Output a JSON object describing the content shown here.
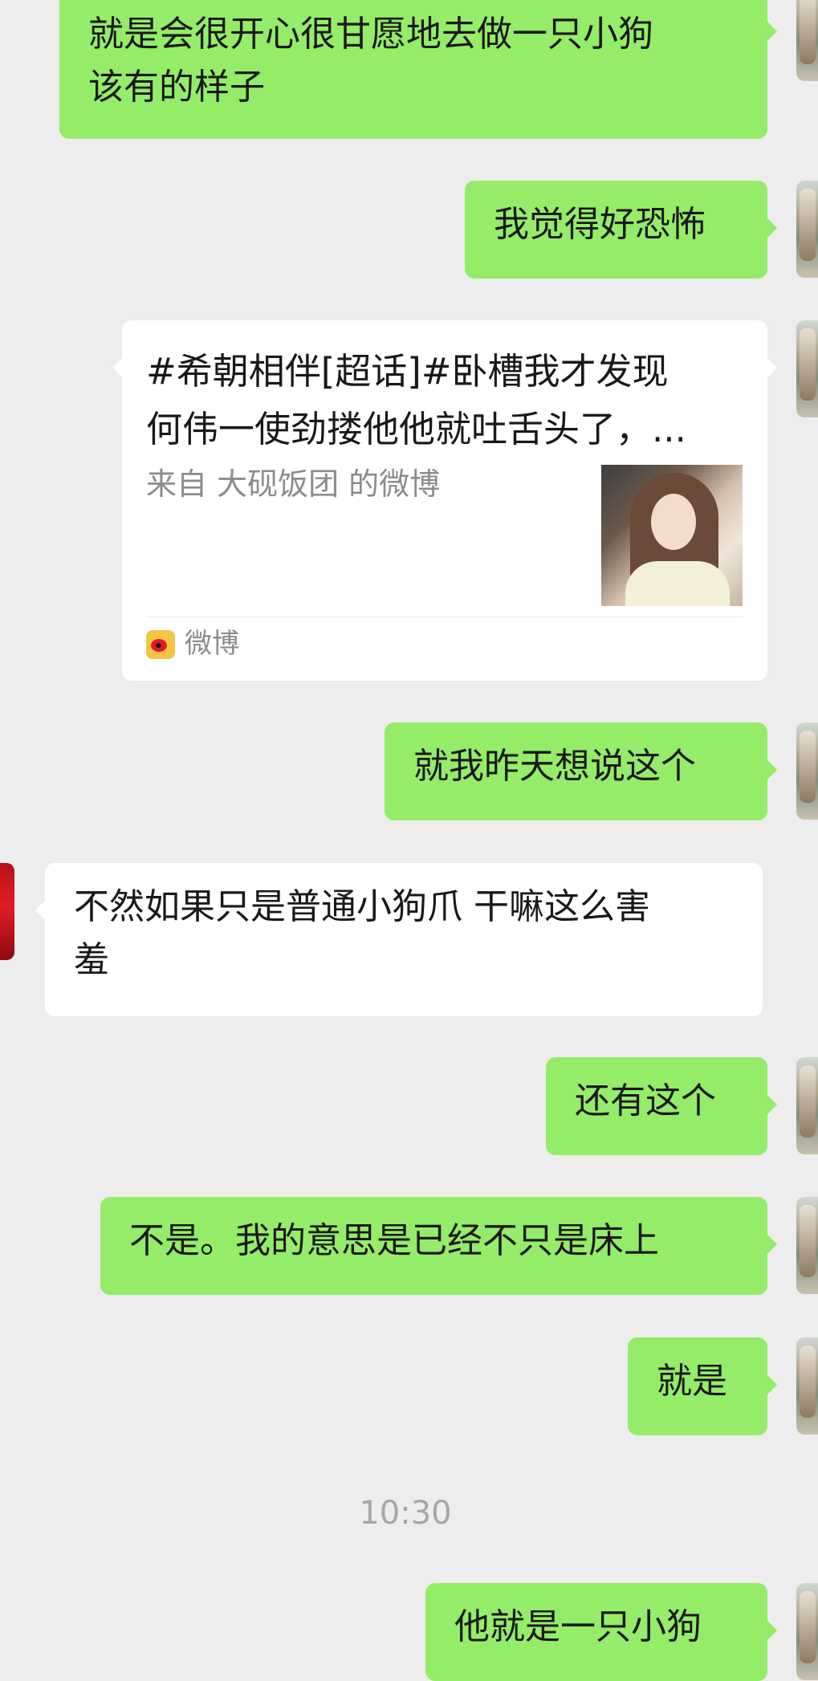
{
  "messages": {
    "m1": "就是会很开心很甘愿地去做一只小狗\n该有的样子",
    "m2": "我觉得好恐怖",
    "m4": "就我昨天想说这个",
    "m5": "不然如果只是普通小狗爪 干嘛这么害\n羞",
    "m6": "还有这个",
    "m7": "不是。我的意思是已经不只是床上",
    "m8": "就是",
    "m9": "他就是一只小狗"
  },
  "card": {
    "title_line1": "#希朝相伴[超话]#卧槽我才发现",
    "title_line2": "何伟一使劲搂他他就吐舌头了，...",
    "source": "来自 大砚饭团 的微博",
    "app": "微博",
    "app_icon": "weibo-icon"
  },
  "timestamp": "10:30",
  "colors": {
    "background": "#ededed",
    "my_bubble": "#95ec69",
    "other_bubble": "#ffffff"
  }
}
